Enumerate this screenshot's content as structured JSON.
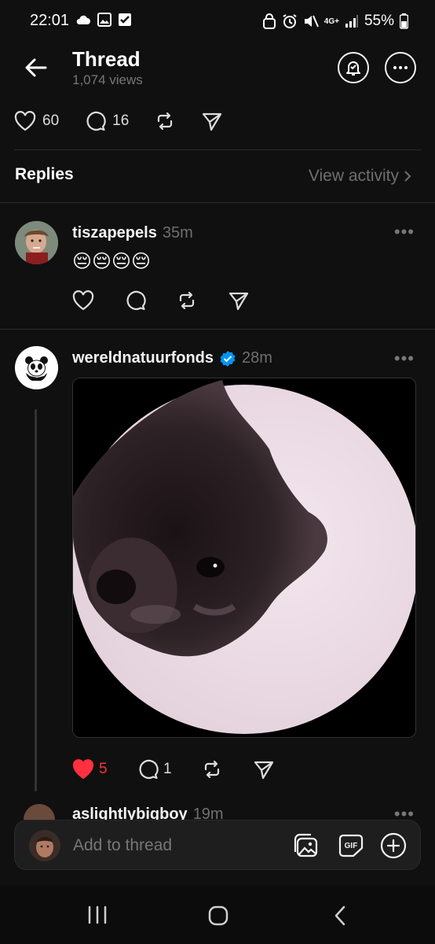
{
  "status_bar": {
    "time": "22:01",
    "battery": "55%",
    "network": "4G+"
  },
  "header": {
    "title": "Thread",
    "views": "1,074 views"
  },
  "post_stats": {
    "likes": "60",
    "comments": "16"
  },
  "replies_section": {
    "title": "Replies",
    "view_activity": "View activity"
  },
  "replies": [
    {
      "username": "tiszapepels",
      "time": "35m",
      "text": "😔😔😔😔"
    },
    {
      "username": "wereldnatuurfonds",
      "verified": true,
      "time": "28m",
      "likes": "5",
      "comments": "1",
      "liked": true
    },
    {
      "username": "aslightlybigboy",
      "time": "19m"
    }
  ],
  "composer": {
    "placeholder": "Add to thread"
  },
  "colors": {
    "background": "#101010",
    "like_red": "#ff3040",
    "verified_blue": "#0095f6",
    "muted": "#6f6f6f"
  }
}
